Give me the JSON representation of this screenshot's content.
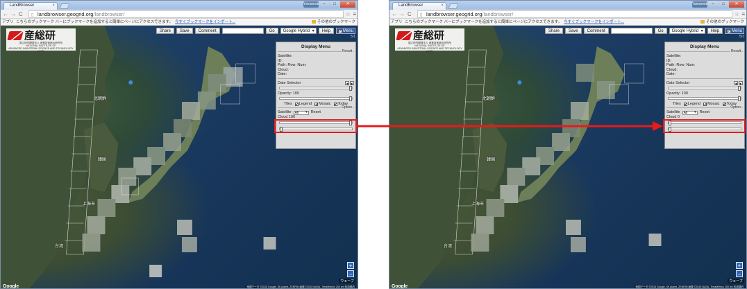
{
  "browser": {
    "tab_title": "LandBrowser",
    "user_button": "Yamamoto",
    "url_host": "landbrowser.geogrid.org",
    "url_path": "/landbrowser/",
    "bookmarks_apps": "アプリ",
    "bookmarks_message": "こちらのブックマーク バーにブックマークを追加すると簡単にページにアクセスできます。",
    "bookmarks_import": "今すぐブックマークをインポート...",
    "other_bookmarks": "その他のブックマーク"
  },
  "toolbar": {
    "share": "Share",
    "save": "Save",
    "comment": "Comment",
    "go": "Go",
    "map_type": "Google Hybrid",
    "help": "Help",
    "menu": "Menu",
    "zoom_readout": "5/1"
  },
  "logo": {
    "name": "産総研",
    "sub1": "国立研究開発法人 産業技術総合研究所",
    "sub2": "NATIONAL INSTITUTE OF",
    "sub3": "ADVANCED INDUSTRIAL SCIENCE AND TECHNOLOGY (AIST)"
  },
  "panel": {
    "title": "Display Menu",
    "result_label": "Result",
    "satellite": "Satellite:",
    "id": "ID:",
    "path_row_num": "Path: Row: Num:",
    "cloud": "Cloud:",
    "date": "Date:",
    "date_selector": "Date Selector",
    "opacity": "Opacity: 100",
    "tiles": "TIles",
    "legend": "Legend",
    "mosaic": "Mosaic",
    "today": "Today",
    "option_label": "Option",
    "satellite_option": "Satellite",
    "satellite_value": "All",
    "reset": "Reset",
    "cloud_left": "Cloud 100",
    "cloud_right": "Cloud 0"
  },
  "map": {
    "labels": {
      "north_korea": "北朝鮮",
      "south_korea": "韓国",
      "taiwan": "台湾",
      "shanghai": "上海市"
    },
    "attribution": "地図データ ©2015 Google, SK planet, ZENRIN 画像 ©2015 NASA, TerraMetrics  200 km",
    "terms": "利用規約",
    "google": "Google",
    "earth_button": "ウェーブ"
  },
  "colors": {
    "highlight": "#e81a1a",
    "ocean": "#1b3b62",
    "land": "#3c4d33"
  }
}
